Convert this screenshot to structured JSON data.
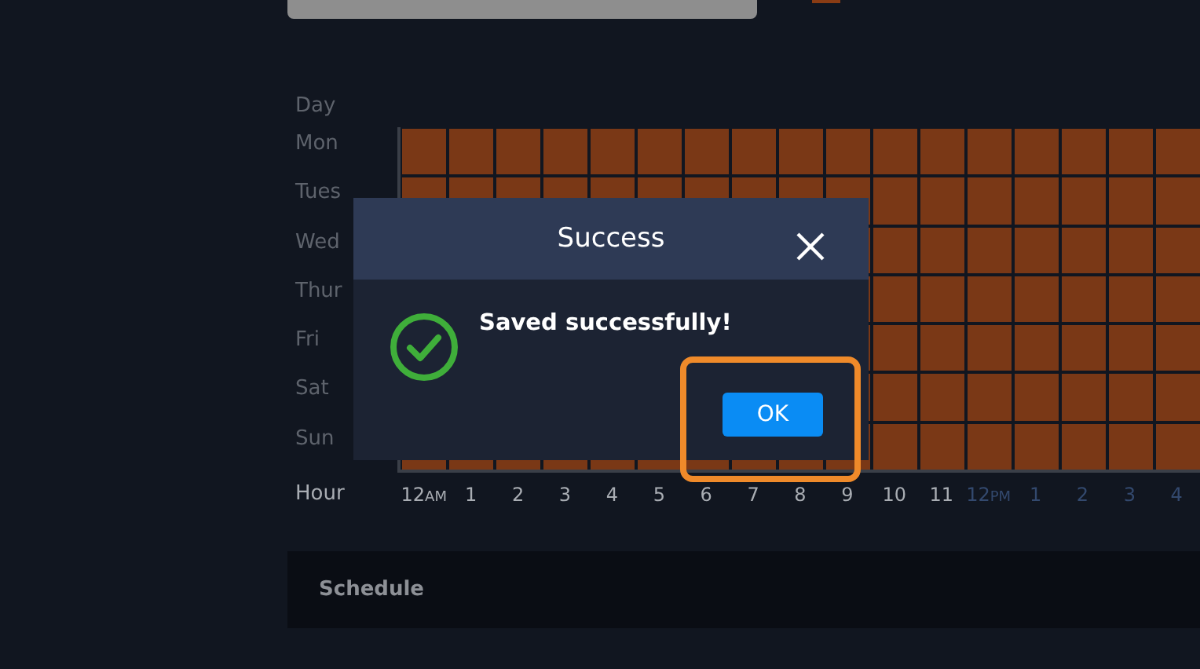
{
  "schedule": {
    "day_header": "Day",
    "hour_header": "Hour",
    "days": [
      {
        "label": "Mon",
        "active": true
      },
      {
        "label": "Tues",
        "active": true
      },
      {
        "label": "Wed",
        "active": true
      },
      {
        "label": "Thur",
        "active": true
      },
      {
        "label": "Fri",
        "active": true
      },
      {
        "label": "Sat",
        "active": true
      },
      {
        "label": "Sun",
        "active": true
      }
    ],
    "hours": [
      {
        "label": "12",
        "suffix": "AM",
        "kind": "morning"
      },
      {
        "label": "1",
        "kind": "morning"
      },
      {
        "label": "2",
        "kind": "morning"
      },
      {
        "label": "3",
        "kind": "morning"
      },
      {
        "label": "4",
        "kind": "morning"
      },
      {
        "label": "5",
        "kind": "morning"
      },
      {
        "label": "6",
        "kind": "morning"
      },
      {
        "label": "7",
        "kind": "morning"
      },
      {
        "label": "8",
        "kind": "morning"
      },
      {
        "label": "9",
        "kind": "morning"
      },
      {
        "label": "10",
        "kind": "morning"
      },
      {
        "label": "11",
        "kind": "morning"
      },
      {
        "label": "12",
        "suffix": "PM",
        "kind": "afternoon"
      },
      {
        "label": "1",
        "kind": "afternoon"
      },
      {
        "label": "2",
        "kind": "afternoon"
      },
      {
        "label": "3",
        "kind": "afternoon"
      },
      {
        "label": "4",
        "kind": "afternoon"
      }
    ]
  },
  "section": {
    "title": "Schedule"
  },
  "dialog": {
    "title": "Success",
    "message": "Saved successfully!",
    "button": "OK"
  }
}
